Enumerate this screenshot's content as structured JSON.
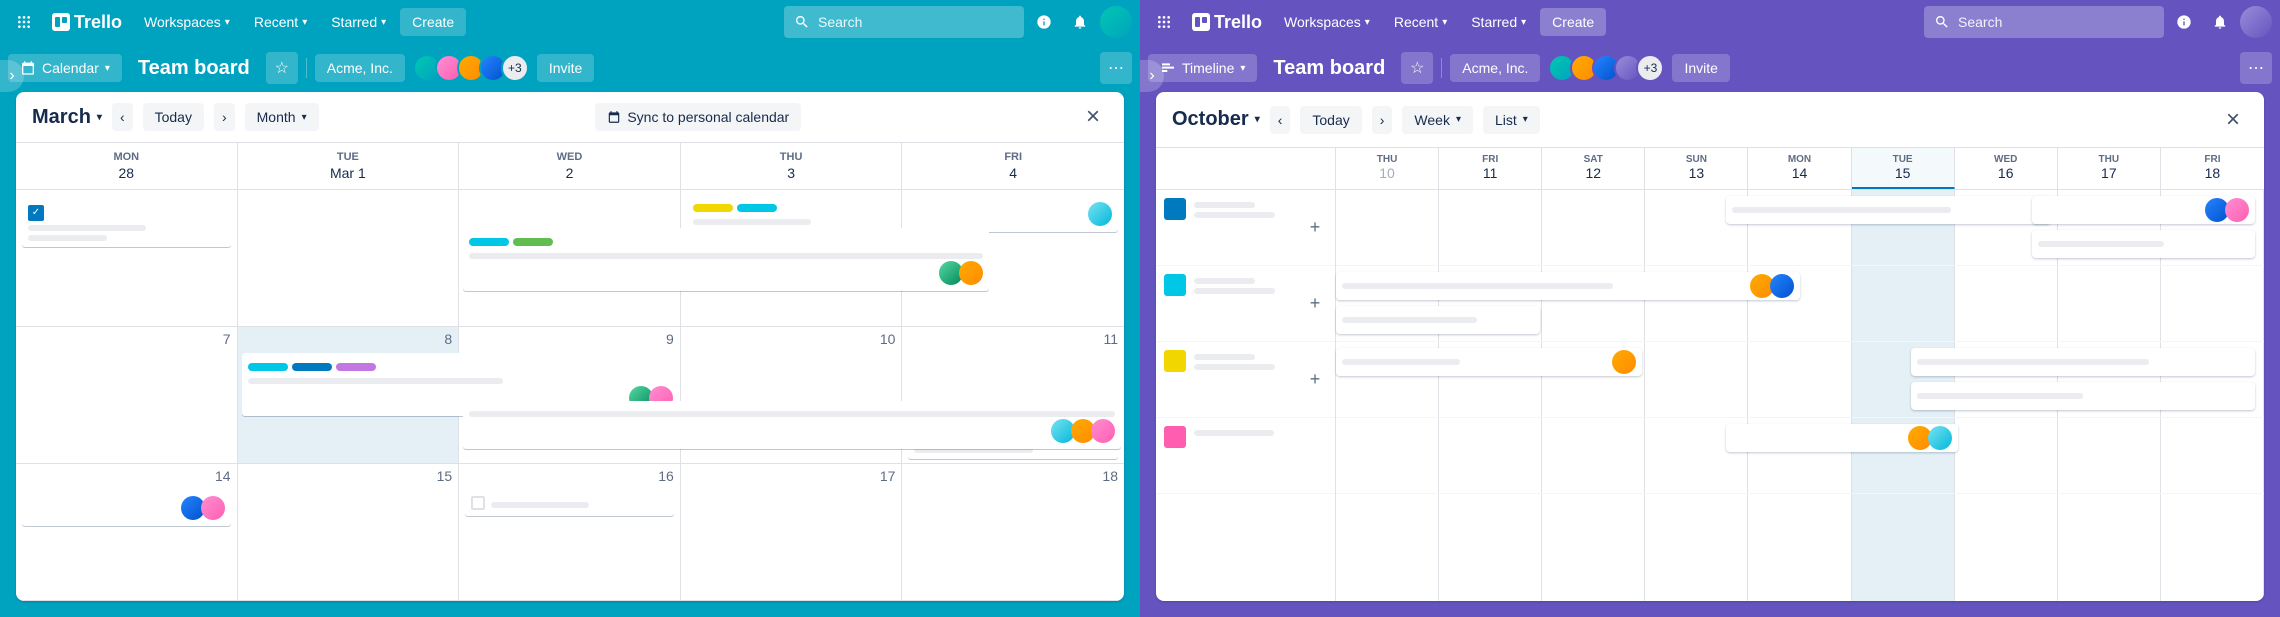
{
  "brand": "Trello",
  "nav": {
    "workspaces": "Workspaces",
    "recent": "Recent",
    "starred": "Starred",
    "create": "Create"
  },
  "search_placeholder": "Search",
  "board": {
    "title": "Team board",
    "workspace": "Acme, Inc.",
    "invite": "Invite",
    "overflow_count": "+3"
  },
  "left": {
    "view_label": "Calendar",
    "month": "March",
    "today": "Today",
    "range": "Month",
    "sync": "Sync to personal calendar",
    "day_labels": [
      "Mon",
      "Tue",
      "Wed",
      "Thu",
      "Fri"
    ],
    "week1": [
      "28",
      "Mar 1",
      "2",
      "3",
      "4"
    ],
    "week2": [
      "7",
      "8",
      "9",
      "10",
      "11"
    ],
    "week3": [
      "14",
      "15",
      "16",
      "17",
      "18"
    ]
  },
  "right": {
    "view_label": "Timeline",
    "month": "October",
    "today": "Today",
    "range": "Week",
    "list": "List",
    "days": [
      {
        "name": "THU",
        "num": "10",
        "muted": true
      },
      {
        "name": "FRI",
        "num": "11"
      },
      {
        "name": "SAT",
        "num": "12"
      },
      {
        "name": "SUN",
        "num": "13"
      },
      {
        "name": "MON",
        "num": "14"
      },
      {
        "name": "TUE",
        "num": "15",
        "today": true
      },
      {
        "name": "WED",
        "num": "16"
      },
      {
        "name": "THU",
        "num": "17"
      },
      {
        "name": "FRI",
        "num": "18"
      }
    ]
  }
}
